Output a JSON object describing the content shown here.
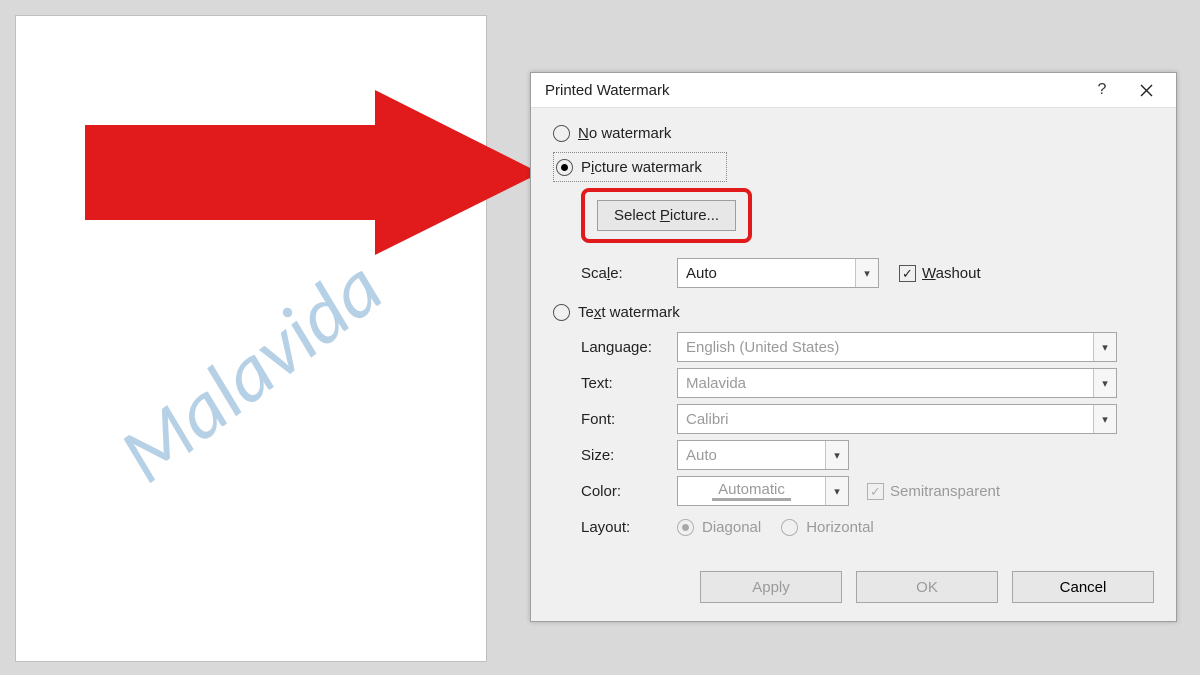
{
  "document": {
    "watermark_text": "Malavida"
  },
  "dialog": {
    "title": "Printed Watermark",
    "radios": {
      "none": "No watermark",
      "picture": "Picture watermark",
      "text": "Text watermark"
    },
    "select_picture_label": "Select Picture...",
    "scale_label": "Scale:",
    "scale_value": "Auto",
    "washout_label": "Washout",
    "fields": {
      "language_label": "Language:",
      "language_value": "English (United States)",
      "text_label": "Text:",
      "text_value": "Malavida",
      "font_label": "Font:",
      "font_value": "Calibri",
      "size_label": "Size:",
      "size_value": "Auto",
      "color_label": "Color:",
      "color_value": "Automatic",
      "semi_label": "Semitransparent",
      "layout_label": "Layout:",
      "layout_diagonal": "Diagonal",
      "layout_horizontal": "Horizontal"
    },
    "buttons": {
      "apply": "Apply",
      "ok": "OK",
      "cancel": "Cancel"
    }
  }
}
